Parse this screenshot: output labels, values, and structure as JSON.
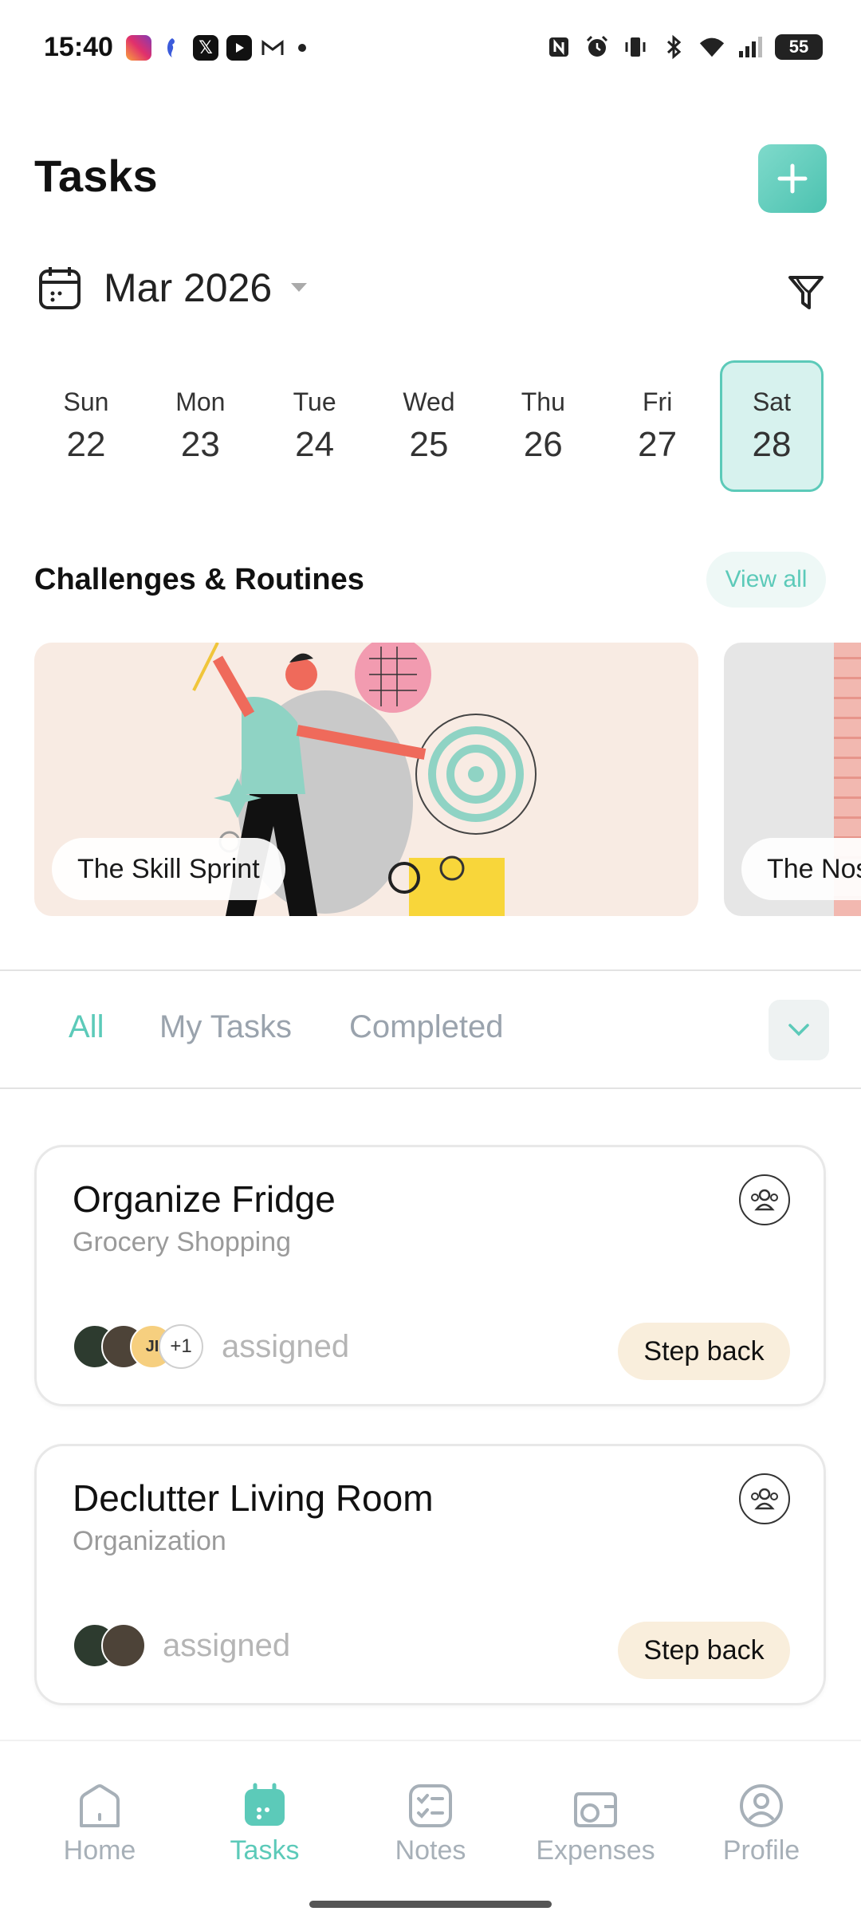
{
  "status_bar": {
    "time": "15:40",
    "battery": "55"
  },
  "header": {
    "title": "Tasks"
  },
  "calendar": {
    "month_label": "Mar 2026",
    "days": [
      {
        "name": "Sun",
        "num": "22"
      },
      {
        "name": "Mon",
        "num": "23"
      },
      {
        "name": "Tue",
        "num": "24"
      },
      {
        "name": "Wed",
        "num": "25"
      },
      {
        "name": "Thu",
        "num": "26"
      },
      {
        "name": "Fri",
        "num": "27"
      },
      {
        "name": "Sat",
        "num": "28"
      }
    ],
    "selected_day": "Sat 28"
  },
  "challenges": {
    "title": "Challenges & Routines",
    "view_all": "View all",
    "items": [
      {
        "label": "The Skill Sprint"
      },
      {
        "label": "The Nos"
      }
    ]
  },
  "filter_tabs": {
    "tabs": [
      "All",
      "My Tasks",
      "Completed"
    ],
    "active": "All"
  },
  "tasks": [
    {
      "title": "Organize Fridge",
      "category": "Grocery Shopping",
      "extra_assignees": "+1",
      "avatar_initials": "JI",
      "assigned_label": "assigned",
      "action_label": "Step back"
    },
    {
      "title": "Declutter Living Room",
      "category": "Organization",
      "assigned_label": "assigned",
      "action_label": "Step back"
    }
  ],
  "bottom_nav": {
    "items": [
      {
        "label": "Home",
        "icon": "home-icon"
      },
      {
        "label": "Tasks",
        "icon": "calendar-icon"
      },
      {
        "label": "Notes",
        "icon": "checklist-icon"
      },
      {
        "label": "Expenses",
        "icon": "wallet-icon"
      },
      {
        "label": "Profile",
        "icon": "user-icon"
      }
    ],
    "active": "Tasks"
  },
  "colors": {
    "accent": "#5ccab9",
    "accent_light": "#d7f2ee",
    "step_back_bg": "#f9eedc",
    "inactive_text": "#a7b0b8"
  }
}
